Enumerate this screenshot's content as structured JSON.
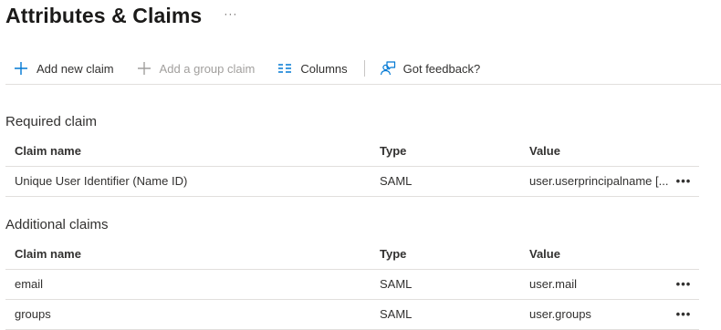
{
  "page": {
    "title": "Attributes & Claims",
    "more_label": "···"
  },
  "toolbar": {
    "add_new_claim": "Add new claim",
    "add_group_claim": "Add a group claim",
    "columns": "Columns",
    "feedback": "Got feedback?"
  },
  "icons": {
    "add": "plus-icon",
    "add_group": "plus-icon",
    "columns": "columns-icon",
    "feedback": "feedback-person-icon"
  },
  "colors": {
    "accent": "#0078d4",
    "disabled": "#a19f9d",
    "border": "#e1dfdd"
  },
  "required": {
    "title": "Required claim",
    "headers": {
      "name": "Claim name",
      "type": "Type",
      "value": "Value"
    },
    "rows": [
      {
        "name": "Unique User Identifier (Name ID)",
        "type": "SAML",
        "value": "user.userprincipalname [...",
        "more": "•••"
      }
    ]
  },
  "additional": {
    "title": "Additional claims",
    "headers": {
      "name": "Claim name",
      "type": "Type",
      "value": "Value"
    },
    "rows": [
      {
        "name": "email",
        "type": "SAML",
        "value": "user.mail",
        "more": "•••"
      },
      {
        "name": "groups",
        "type": "SAML",
        "value": "user.groups",
        "more": "•••"
      }
    ]
  }
}
